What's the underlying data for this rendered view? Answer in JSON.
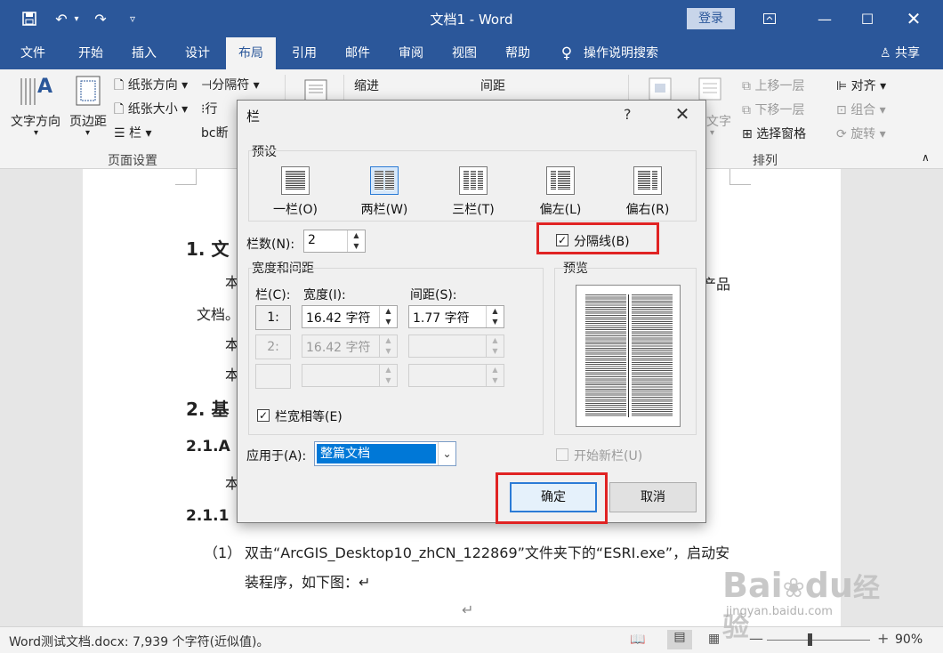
{
  "window": {
    "title": "文档1  -  Word",
    "login_label": "登录",
    "qat": {
      "save_icon": "save-icon",
      "undo_icon": "undo-icon",
      "redo_icon": "redo-icon"
    }
  },
  "tabs": [
    {
      "label": "文件"
    },
    {
      "label": "开始"
    },
    {
      "label": "插入"
    },
    {
      "label": "设计"
    },
    {
      "label": "布局",
      "active": true
    },
    {
      "label": "引用"
    },
    {
      "label": "邮件"
    },
    {
      "label": "审阅"
    },
    {
      "label": "视图"
    },
    {
      "label": "帮助"
    }
  ],
  "tell_me": "操作说明搜索",
  "share": "共享",
  "ribbon": {
    "text_direction": "文字方向",
    "margins": "页边距",
    "orientation": "纸张方向",
    "size": "纸张大小",
    "columns": "栏",
    "breaks": "分隔符",
    "line_numbers": "行",
    "hyphenation": "断",
    "indent": "缩进",
    "spacing": "间距",
    "wrap_text": "文字",
    "bring_forward": "上移一层",
    "send_backward": "下移一层",
    "selection_pane": "选择窗格",
    "align": "对齐",
    "group": "组合",
    "rotate": "旋转",
    "page_setup_group": "页面设置",
    "arrange_group": "排列"
  },
  "document": {
    "h1_1": "1. 文",
    "p_1": "本",
    "p_1_right": "产品",
    "p_2": "文档。",
    "p_3": "本",
    "p_4": "本",
    "h1_2": "2. 基",
    "h2_1": "2.1.A",
    "p_5": "本",
    "h3_1": "2.1.1",
    "list_num": "（1）",
    "list_text_1": "双击“ArcGIS_Desktop10_zhCN_122869”文件夹下的“ESRI.exe”，启动安",
    "list_text_2": "装程序，如下图：↵",
    "para_mark": "↵"
  },
  "status": {
    "text": "Word测试文档.docx: 7,939 个字符(近似值)。",
    "zoom": "90%"
  },
  "dialog": {
    "title": "栏",
    "help": "?",
    "presets_label": "预设",
    "presets": [
      {
        "label": "一栏(O)",
        "cols": 1
      },
      {
        "label": "两栏(W)",
        "cols": 2,
        "selected": true
      },
      {
        "label": "三栏(T)",
        "cols": 3
      },
      {
        "label": "偏左(L)",
        "cols": 2
      },
      {
        "label": "偏右(R)",
        "cols": 2
      }
    ],
    "num_cols_label": "栏数(N):",
    "num_cols_value": "2",
    "line_between_label": "分隔线(B)",
    "line_between_checked": true,
    "width_spacing_label": "宽度和间距",
    "col_header": "栏(C):",
    "width_header": "宽度(I):",
    "spacing_header": "间距(S):",
    "rows": [
      {
        "num": "1:",
        "width": "16.42 字符",
        "spacing": "1.77 字符",
        "enabled": true
      },
      {
        "num": "2:",
        "width": "16.42 字符",
        "spacing": "",
        "enabled": false
      },
      {
        "num": "",
        "width": "",
        "spacing": "",
        "enabled": false
      }
    ],
    "equal_width_label": "栏宽相等(E)",
    "equal_width_checked": true,
    "preview_label": "预览",
    "apply_to_label": "应用于(A):",
    "apply_to_value": "整篇文档",
    "start_new_col_label": "开始新栏(U)",
    "ok_label": "确定",
    "cancel_label": "取消"
  },
  "watermark": {
    "brand": "Bai",
    "brand2": "du",
    "sub": "经验",
    "url": "jingyan.baidu.com"
  }
}
